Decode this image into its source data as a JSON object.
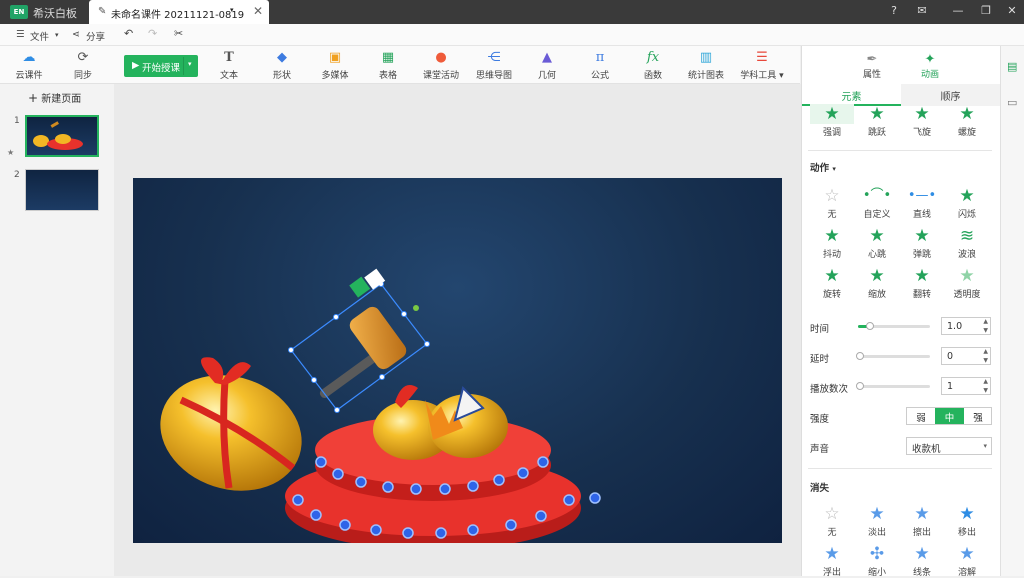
{
  "app": {
    "logo_text": "EN",
    "name": "希沃白板"
  },
  "tab": {
    "title": "未命名课件 20211121-0819",
    "caret": "▾",
    "close": "✕"
  },
  "window_buttons": [
    "?",
    "✉",
    "—",
    "❐",
    "✕"
  ],
  "menu": {
    "file": "文件",
    "share": "分享"
  },
  "toolbar": {
    "cloud": "云课件",
    "sync": "同步",
    "start": "开始授课",
    "tools": [
      "文本",
      "形状",
      "多媒体",
      "表格",
      "课堂活动",
      "思维导图",
      "几何",
      "公式",
      "函数",
      "统计图表",
      "学科工具"
    ]
  },
  "left": {
    "new_page": "新建页面",
    "slides": [
      "1",
      "2"
    ]
  },
  "right": {
    "tab_properties": "属性",
    "tab_animation": "动画",
    "sub_elements": "元素",
    "sub_order": "顺序",
    "top_row": [
      "强调",
      "跳跃",
      "飞旋",
      "螺旋"
    ],
    "action_title": "动作",
    "actions": [
      "无",
      "自定义",
      "直线",
      "闪烁",
      "抖动",
      "心跳",
      "弹跳",
      "波浪",
      "旋转",
      "缩放",
      "翻转",
      "透明度"
    ],
    "time_label": "时间",
    "time_value": "1.0",
    "delay_label": "延时",
    "delay_value": "0",
    "repeat_label": "播放数次",
    "repeat_value": "1",
    "strength_label": "强度",
    "strength_options": [
      "弱",
      "中",
      "强"
    ],
    "sound_label": "声音",
    "sound_value": "收款机",
    "exit_title": "消失",
    "exits": [
      "无",
      "淡出",
      "擦出",
      "移出",
      "浮出",
      "缩小",
      "线条",
      "溶解"
    ]
  },
  "colors": {
    "accent": "#24b35d",
    "titlebar": "#3a3a3a",
    "slide_bg": "#17304f",
    "stage_red": "#e8322c",
    "gold": "#f2b724"
  }
}
